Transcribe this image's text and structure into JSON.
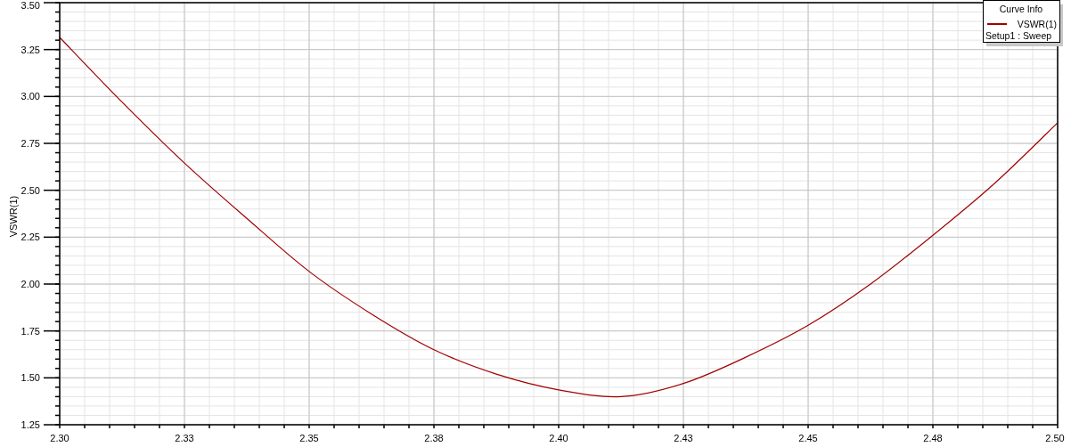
{
  "plot": {
    "chart_data": {
      "type": "line",
      "grid": true,
      "ylabel": "VSWR(1)",
      "x": [
        2.3,
        2.3125,
        2.325,
        2.3375,
        2.35,
        2.3625,
        2.375,
        2.3875,
        2.4,
        2.4125,
        2.425,
        2.4375,
        2.45,
        2.4625,
        2.475,
        2.4875,
        2.5
      ],
      "series": [
        {
          "name": "VSWR(1)",
          "color": "#a00000",
          "values": [
            3.315,
            2.97,
            2.645,
            2.35,
            2.067,
            1.84,
            1.65,
            1.52,
            1.436,
            1.4,
            1.47,
            1.61,
            1.78,
            2.0,
            2.26,
            2.54,
            2.86
          ]
        }
      ],
      "xlim": [
        2.3,
        2.5
      ],
      "ylim": [
        1.25,
        3.5
      ],
      "xticks": [
        {
          "value": 2.3,
          "label": "2.30"
        },
        {
          "value": 2.325,
          "label": "2.33"
        },
        {
          "value": 2.35,
          "label": "2.35"
        },
        {
          "value": 2.375,
          "label": "2.38"
        },
        {
          "value": 2.4,
          "label": "2.40"
        },
        {
          "value": 2.425,
          "label": "2.43"
        },
        {
          "value": 2.45,
          "label": "2.45"
        },
        {
          "value": 2.475,
          "label": "2.48"
        },
        {
          "value": 2.5,
          "label": "2.50"
        }
      ],
      "yticks": [
        {
          "value": 1.25,
          "label": "1.25"
        },
        {
          "value": 1.5,
          "label": "1.50"
        },
        {
          "value": 1.75,
          "label": "1.75"
        },
        {
          "value": 2.0,
          "label": "2.00"
        },
        {
          "value": 2.25,
          "label": "2.25"
        },
        {
          "value": 2.5,
          "label": "2.50"
        },
        {
          "value": 2.75,
          "label": "2.75"
        },
        {
          "value": 3.0,
          "label": "3.00"
        },
        {
          "value": 3.25,
          "label": "3.25"
        },
        {
          "value": 3.5,
          "label": "3.50"
        }
      ]
    },
    "legend": {
      "title": "Curve Info",
      "setup": "Setup1 : Sweep"
    }
  }
}
